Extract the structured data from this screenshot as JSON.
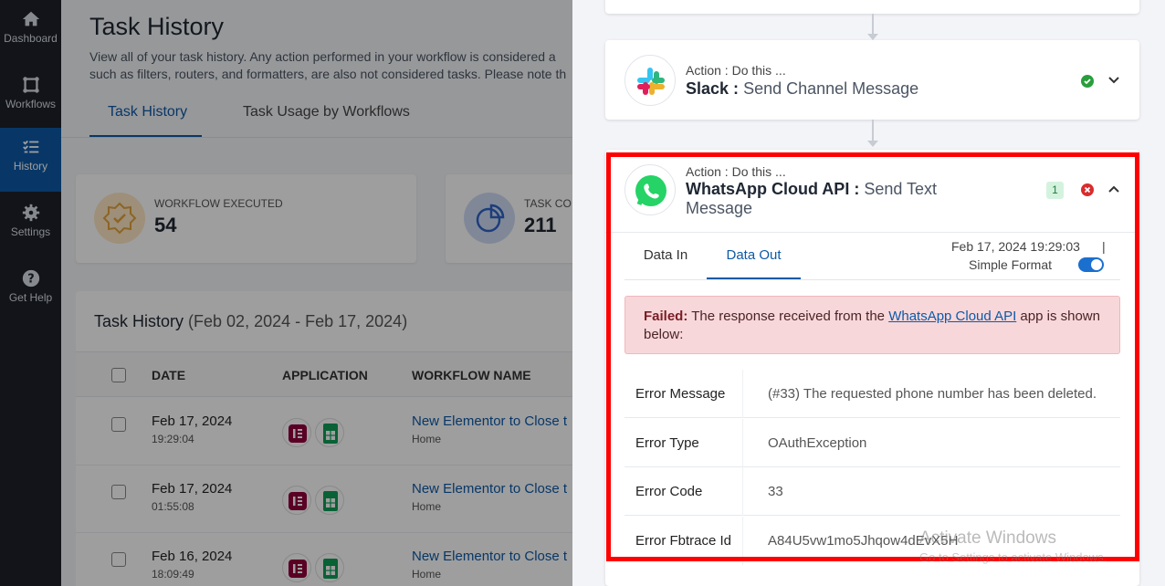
{
  "sidebar": {
    "items": [
      {
        "label": "Dashboard",
        "icon": "home-icon"
      },
      {
        "label": "Workflows",
        "icon": "workflow-icon"
      },
      {
        "label": "History",
        "icon": "history-list-icon",
        "active": true
      },
      {
        "label": "Settings",
        "icon": "gear-icon"
      },
      {
        "label": "Get Help",
        "icon": "question-icon"
      }
    ]
  },
  "page": {
    "title": "Task History",
    "desc_line1": "View all of your task history. Any action performed in your workflow is considered a",
    "desc_line2": "such as filters, routers, and formatters, are also not considered tasks. Please note th",
    "tabs": [
      {
        "label": "Task History",
        "active": true
      },
      {
        "label": "Task Usage by Workflows",
        "active": false
      }
    ]
  },
  "stats": [
    {
      "label": "WORKFLOW EXECUTED",
      "value": "54"
    },
    {
      "label": "TASK CO",
      "value": "211"
    }
  ],
  "history": {
    "title": "Task History",
    "range": "(Feb 02, 2024 - Feb 17, 2024)",
    "columns": [
      "DATE",
      "APPLICATION",
      "WORKFLOW NAME"
    ],
    "rows": [
      {
        "date": "Feb 17, 2024",
        "time": "19:29:04",
        "workflow": "New Elementor to Close t",
        "folder": "Home"
      },
      {
        "date": "Feb 17, 2024",
        "time": "01:55:08",
        "workflow": "New Elementor to Close t",
        "folder": "Home"
      },
      {
        "date": "Feb 16, 2024",
        "time": "18:09:49",
        "workflow": "New Elementor to Close t",
        "folder": "Home"
      }
    ]
  },
  "drawer": {
    "slack_step": {
      "action": "Action : Do this ...",
      "app": "Slack :",
      "event": "Send Channel Message"
    },
    "whatsapp_step": {
      "action": "Action : Do this ...",
      "app": "WhatsApp Cloud API :",
      "event_line1": "Send Text",
      "event_line2": "Message",
      "count": "1"
    },
    "data_tabs": [
      {
        "label": "Data In",
        "active": false
      },
      {
        "label": "Data Out",
        "active": true
      }
    ],
    "timestamp": "Feb 17, 2024 19:29:03",
    "separator": "|",
    "format_label": "Simple Format",
    "alert": {
      "prefix": "Failed:",
      "text_before": " The response received from the ",
      "link": "WhatsApp Cloud API",
      "text_after": " app is shown below:"
    },
    "fields": [
      {
        "key": "Error Message",
        "value": "(#33) The requested phone number has been deleted."
      },
      {
        "key": "Error Type",
        "value": "OAuthException"
      },
      {
        "key": "Error Code",
        "value": "33"
      },
      {
        "key": "Error Fbtrace Id",
        "value": "A84U5vw1mo5Jhqow4dEvX5H"
      }
    ]
  },
  "watermark": {
    "line1": "Activate Windows",
    "line2": "Go to Settings to activate Windows."
  },
  "colors": {
    "brand": "#0d5aa7",
    "error": "#d92c2c",
    "success": "#2a9d3d",
    "highlight": "#ff0000"
  }
}
